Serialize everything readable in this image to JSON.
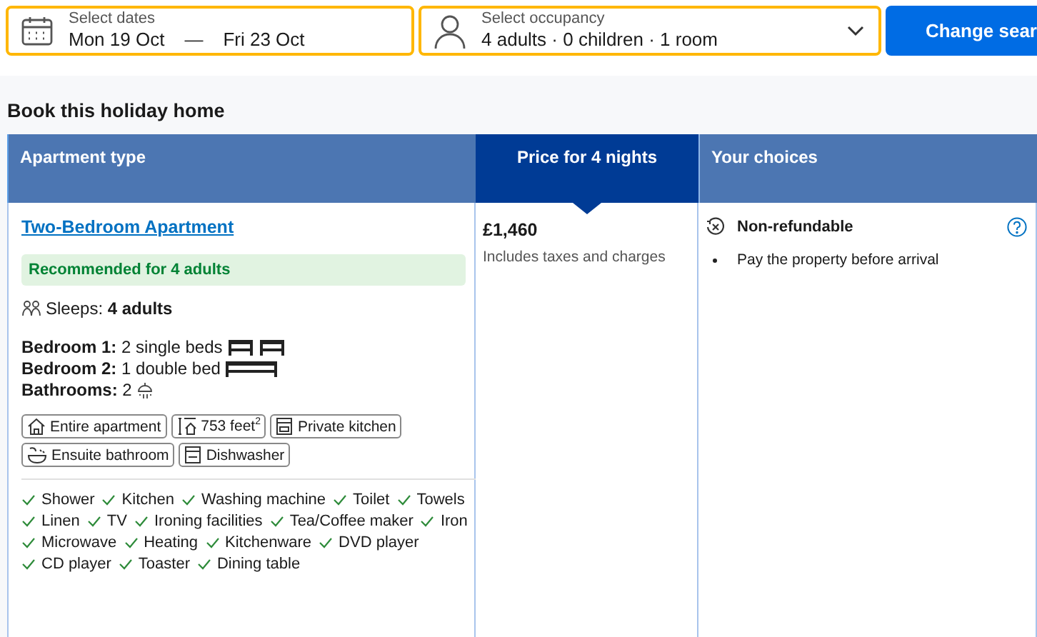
{
  "search": {
    "dates": {
      "label": "Select dates",
      "start": "Mon 19 Oct",
      "separator": "—",
      "end": "Fri 23 Oct"
    },
    "occupancy": {
      "label": "Select occupancy",
      "value": "4 adults · 0 children · 1 room"
    },
    "button": "Change sear"
  },
  "heading": "Book this holiday home",
  "columns": [
    {
      "label": "Apartment type",
      "selected": false
    },
    {
      "label": "Price for 4 nights",
      "selected": true
    },
    {
      "label": "Your choices",
      "selected": false
    }
  ],
  "room": {
    "name": "Two-Bedroom Apartment",
    "badge": "Recommended for 4 adults",
    "sleeps_label": "Sleeps:",
    "sleeps": "4 adults",
    "beds": [
      {
        "label": "Bedroom 1:",
        "value": "2 single beds",
        "icons": [
          {
            "kind": "single"
          },
          {
            "kind": "single"
          }
        ]
      },
      {
        "label": "Bedroom 2:",
        "value": "1 double bed",
        "icons": [
          {
            "kind": "double"
          }
        ]
      }
    ],
    "bathrooms": {
      "label": "Bathrooms:",
      "value": "2"
    },
    "facilities": [
      {
        "kind": "house",
        "label": "Entire apartment"
      },
      {
        "kind": "size",
        "label": "753 feet$^{2}$"
      },
      {
        "kind": "kitchen",
        "label": "Private kitchen"
      },
      {
        "kind": "bath",
        "label": "Ensuite bathroom"
      },
      {
        "kind": "dishwasher",
        "label": "Dishwasher"
      }
    ],
    "amenities": [
      "Shower",
      "Kitchen",
      "Washing machine",
      "Toilet",
      "Towels",
      "Linen",
      "TV",
      "Ironing facilities",
      "Tea/Coffee maker",
      "Iron",
      "Microwave",
      "Heating",
      "Kitchenware",
      "DVD player",
      "CD player",
      "Toaster",
      "Dining table"
    ]
  },
  "price": {
    "amount": "£1,460",
    "note": "Includes taxes and charges"
  },
  "choices": {
    "title": "Non-refundable",
    "items": [
      "Pay the property before arrival"
    ]
  }
}
